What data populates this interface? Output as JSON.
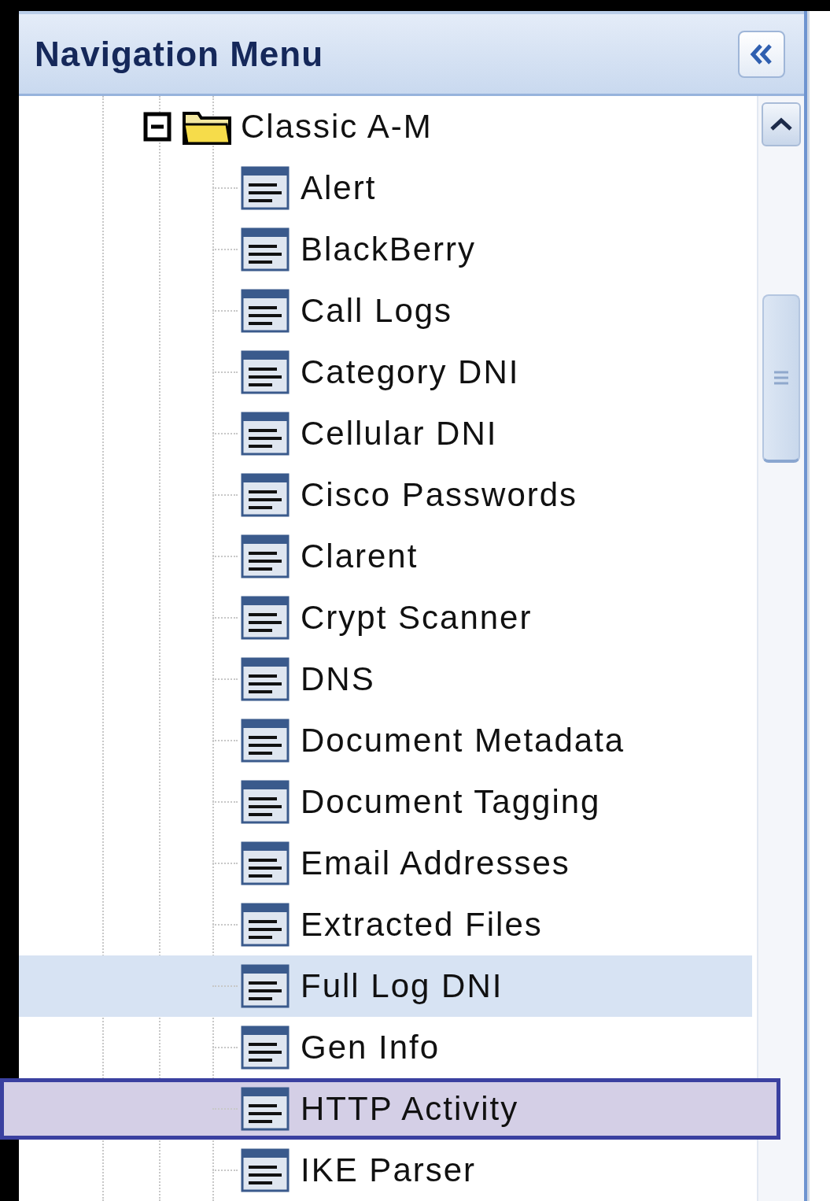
{
  "panel": {
    "title": "Navigation Menu"
  },
  "tree": [
    {
      "label": "Classic A-M",
      "expanded": true,
      "children": [
        {
          "label": "Alert",
          "selected": false,
          "marked": false
        },
        {
          "label": "BlackBerry",
          "selected": false,
          "marked": false
        },
        {
          "label": "Call Logs",
          "selected": false,
          "marked": false
        },
        {
          "label": "Category DNI",
          "selected": false,
          "marked": false
        },
        {
          "label": "Cellular DNI",
          "selected": false,
          "marked": false
        },
        {
          "label": "Cisco Passwords",
          "selected": false,
          "marked": false
        },
        {
          "label": "Clarent",
          "selected": false,
          "marked": false
        },
        {
          "label": "Crypt Scanner",
          "selected": false,
          "marked": false
        },
        {
          "label": "DNS",
          "selected": false,
          "marked": false
        },
        {
          "label": "Document Metadata",
          "selected": false,
          "marked": false
        },
        {
          "label": "Document Tagging",
          "selected": false,
          "marked": false
        },
        {
          "label": "Email Addresses",
          "selected": false,
          "marked": false
        },
        {
          "label": "Extracted Files",
          "selected": false,
          "marked": false
        },
        {
          "label": "Full Log DNI",
          "selected": true,
          "marked": false
        },
        {
          "label": "Gen Info",
          "selected": false,
          "marked": false
        },
        {
          "label": "HTTP Activity",
          "selected": false,
          "marked": true
        },
        {
          "label": "IKE Parser",
          "selected": false,
          "marked": false
        }
      ]
    }
  ]
}
